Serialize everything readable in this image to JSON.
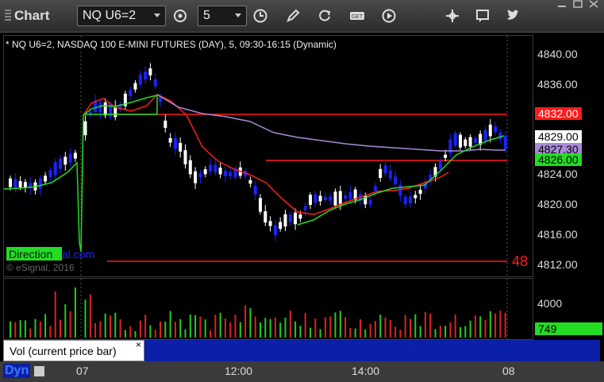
{
  "toolbar": {
    "title": "Chart",
    "symbol": "NQ U6=2",
    "interval": "5",
    "icons": [
      "target-icon",
      "clock-icon",
      "pencil-icon",
      "refresh-icon",
      "get-icon",
      "play-icon",
      "crosshair-icon",
      "comment-icon",
      "twitter-icon"
    ]
  },
  "legend": "* NQ U6=2, NASDAQ 100 E-MINI FUTURES (DAY), 5, 09:30-16:15 (Dynamic)",
  "watermark": {
    "brand_left": "Direction",
    "brand_right": "al.com",
    "copyright": "© eSignal, 2016"
  },
  "price_scale": {
    "ticks": [
      "4840.00",
      "4836.00",
      "4832.00",
      "4829.00",
      "4827.30",
      "4826.00",
      "4824.00",
      "4820.00",
      "4816.00",
      "4812.00"
    ],
    "tags": {
      "red": "4832.00",
      "white": "4829.00",
      "purple": "4827.30",
      "green": "4826.00"
    }
  },
  "line_label": "48",
  "volume": {
    "tick": "4000",
    "tag": "749",
    "title": "Vol (current price bar)",
    "close": "×"
  },
  "time_axis": {
    "labels": [
      "07",
      "12:00",
      "14:00",
      "08"
    ],
    "dyn": "Dyn"
  },
  "colors": {
    "up": "#ffffff",
    "down": "#1a23ff",
    "red": "#ff1a1a",
    "green": "#22dd22",
    "purple": "#a98ad6",
    "volume_bar": "#0b1fa8"
  }
}
